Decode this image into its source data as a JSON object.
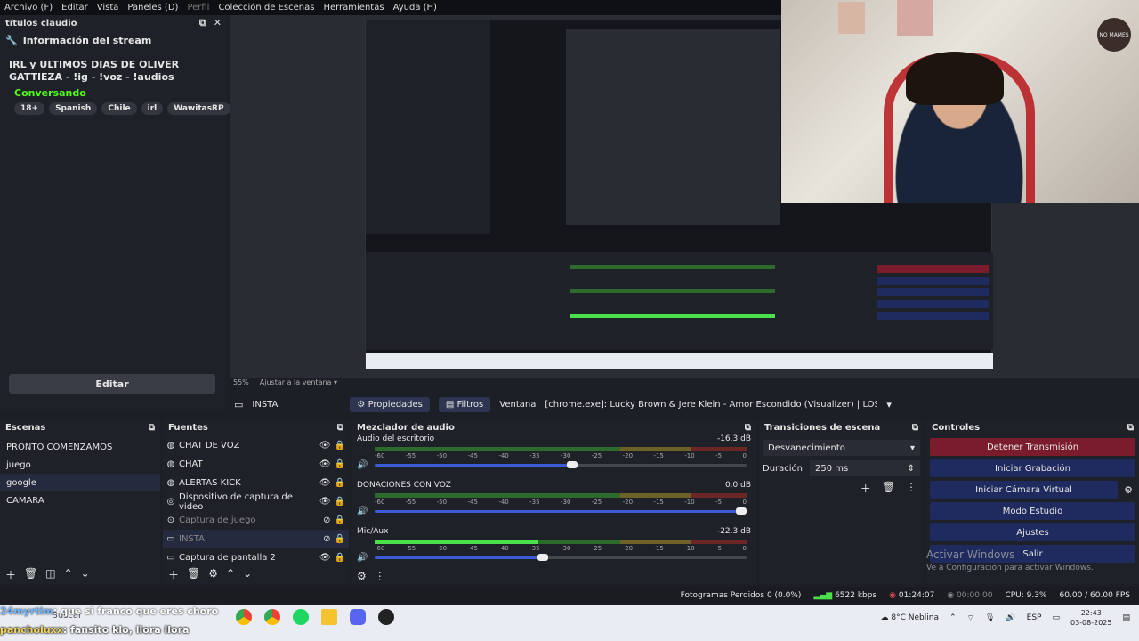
{
  "menu": [
    "Archivo (F)",
    "Editar",
    "Vista",
    "Paneles (D)",
    "Perfil",
    "Colección de Escenas",
    "Herramientas",
    "Ayuda (H)"
  ],
  "info_dock": {
    "title": "títulos claudio",
    "section": "Información del stream",
    "stream_title": "IRL y ULTIMOS DIAS DE OLIVER GATTIEZA - !ig - !voz - !audios",
    "category": "Conversando",
    "tags": [
      "18+",
      "Spanish",
      "Chile",
      "irl",
      "WawitasRP"
    ],
    "edit_label": "Editar"
  },
  "webcam": {
    "sign_text": "NO MAMES"
  },
  "preview": {
    "zoom": "55%",
    "fit_label": "Ajustar a la ventana"
  },
  "source_bar": {
    "source_name": "INSTA",
    "properties": "Propiedades",
    "filters": "Filtros",
    "window_label": "Ventana",
    "window_value": "[chrome.exe]: Lucky Brown & Jere Klein - Amor Escondido (Visualizer) | LOS GALÁCTICOS - You"
  },
  "scenes": {
    "title": "Escenas",
    "items": [
      "PRONTO COMENZAMOS",
      "juego",
      "google",
      "CAMARA"
    ]
  },
  "sources": {
    "title": "Fuentes",
    "items": [
      "CHAT DE VOZ",
      "CHAT",
      "ALERTAS KICK",
      "Dispositivo de captura de video",
      "Captura de juego",
      "INSTA",
      "Captura de pantalla 2"
    ]
  },
  "mixer": {
    "title": "Mezclador de audio",
    "scale": [
      "-60",
      "-55",
      "-50",
      "-45",
      "-40",
      "-35",
      "-30",
      "-25",
      "-20",
      "-15",
      "-10",
      "-5",
      "0"
    ],
    "channels": [
      {
        "name": "Audio del escritorio",
        "db": "-16.3 dB",
        "volume": 0.53
      },
      {
        "name": "DONACIONES CON VOZ",
        "db": "0.0 dB",
        "volume": 1.0
      },
      {
        "name": "Mic/Aux",
        "db": "-22.3 dB",
        "volume": 0.45
      }
    ]
  },
  "transitions": {
    "title": "Transiciones de escena",
    "selected": "Desvanecimiento",
    "duration_label": "Duración",
    "duration_value": "250 ms"
  },
  "controls": {
    "title": "Controles",
    "buttons": [
      "Detener Transmisión",
      "Iniciar Grabación",
      "Iniciar Cámara Virtual",
      "Modo Estudio",
      "Ajustes",
      "Salir"
    ],
    "activate_title": "Activar Windows",
    "activate_sub": "Ve a Configuración para activar Windows."
  },
  "status": {
    "dropped": "Fotogramas Perdidos 0 (0.0%)",
    "bitrate": "6522 kbps",
    "live_time": "01:24:07",
    "rec_time": "00:00:00",
    "cpu": "CPU: 9.3%",
    "fps": "60.00 / 60.00 FPS"
  },
  "chat": {
    "user1": "24myrtim",
    "msg1": ": que si franco que eres choro",
    "user2": "pancholuxx",
    "msg2": ": fansito klo, llora llora"
  },
  "taskbar": {
    "search": "Buscar",
    "weather": "8°C  Neblina",
    "lang": "ESP",
    "time": "22:43",
    "date": "03-08-2025"
  }
}
